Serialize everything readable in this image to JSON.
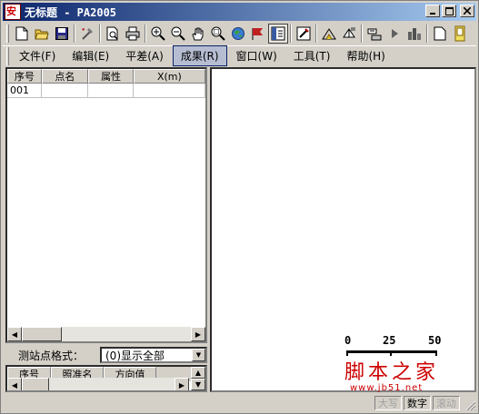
{
  "window": {
    "title": "无标题 - PA2005",
    "logo_text": "安"
  },
  "toolbar": {
    "icons": [
      "new-file-icon",
      "open-folder-icon",
      "save-icon",
      "tools-icon",
      "print-preview-icon",
      "print-icon",
      "zoom-in-icon",
      "zoom-out-icon",
      "pan-hand-icon",
      "zoom-window-icon",
      "globe-icon",
      "flag-icon",
      "panel-icon",
      "edit-icon",
      "triangle-icon",
      "network-icon",
      "station-icon",
      "play-icon",
      "building-icon",
      "page-icon",
      "active-icon"
    ]
  },
  "menu": {
    "items": [
      {
        "label": "文件(F)"
      },
      {
        "label": "编辑(E)"
      },
      {
        "label": "平差(A)"
      },
      {
        "label": "成果(R)",
        "active": true
      },
      {
        "label": "窗口(W)"
      },
      {
        "label": "工具(T)"
      },
      {
        "label": "帮助(H)"
      }
    ]
  },
  "point_table": {
    "columns": [
      "序号",
      "点名",
      "属性",
      "X(m)"
    ],
    "rows": [
      [
        "001",
        "",
        "",
        ""
      ]
    ]
  },
  "station_format": {
    "label": "测站点格式：",
    "value": "(0)显示全部"
  },
  "obs_table": {
    "columns": [
      "序号",
      "照准名",
      "方向值"
    ]
  },
  "scale": {
    "ticks": [
      "0",
      "25",
      "50"
    ]
  },
  "watermark": {
    "main": "脚本之家",
    "url": "www.jb51.net"
  },
  "status": {
    "caps": "大写",
    "num": "数字",
    "scroll": "滚动"
  }
}
